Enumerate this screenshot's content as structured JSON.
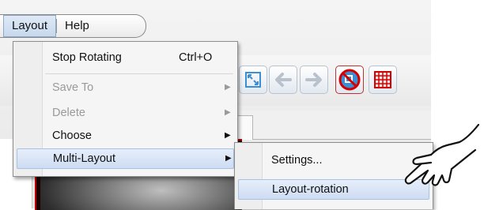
{
  "menubar": {
    "items": [
      {
        "label": "Layout",
        "active": true
      },
      {
        "label": "Help",
        "active": false
      }
    ]
  },
  "dropdown": {
    "items": [
      {
        "label": "Stop Rotating",
        "shortcut": "Ctrl+O",
        "enabled": true,
        "submenu": false
      },
      {
        "label": "Save To",
        "enabled": false,
        "submenu": true
      },
      {
        "label": "Delete",
        "enabled": false,
        "submenu": true
      },
      {
        "label": "Choose",
        "enabled": true,
        "submenu": true
      },
      {
        "label": "Multi-Layout",
        "enabled": true,
        "submenu": true,
        "highlighted": true
      }
    ]
  },
  "submenu": {
    "items": [
      {
        "label": "Settings...",
        "highlighted": false
      },
      {
        "label": "Layout-rotation",
        "highlighted": true
      }
    ]
  },
  "toolbar": {
    "icons": [
      "fullscreen-icon",
      "arrow-left-icon",
      "arrow-right-icon",
      "no-rotate-icon",
      "grid-layout-icon"
    ]
  },
  "colors": {
    "accent_red": "#d40000",
    "menu_highlight": "#cddcf2",
    "toolbar_blue": "#3b8fd6"
  }
}
